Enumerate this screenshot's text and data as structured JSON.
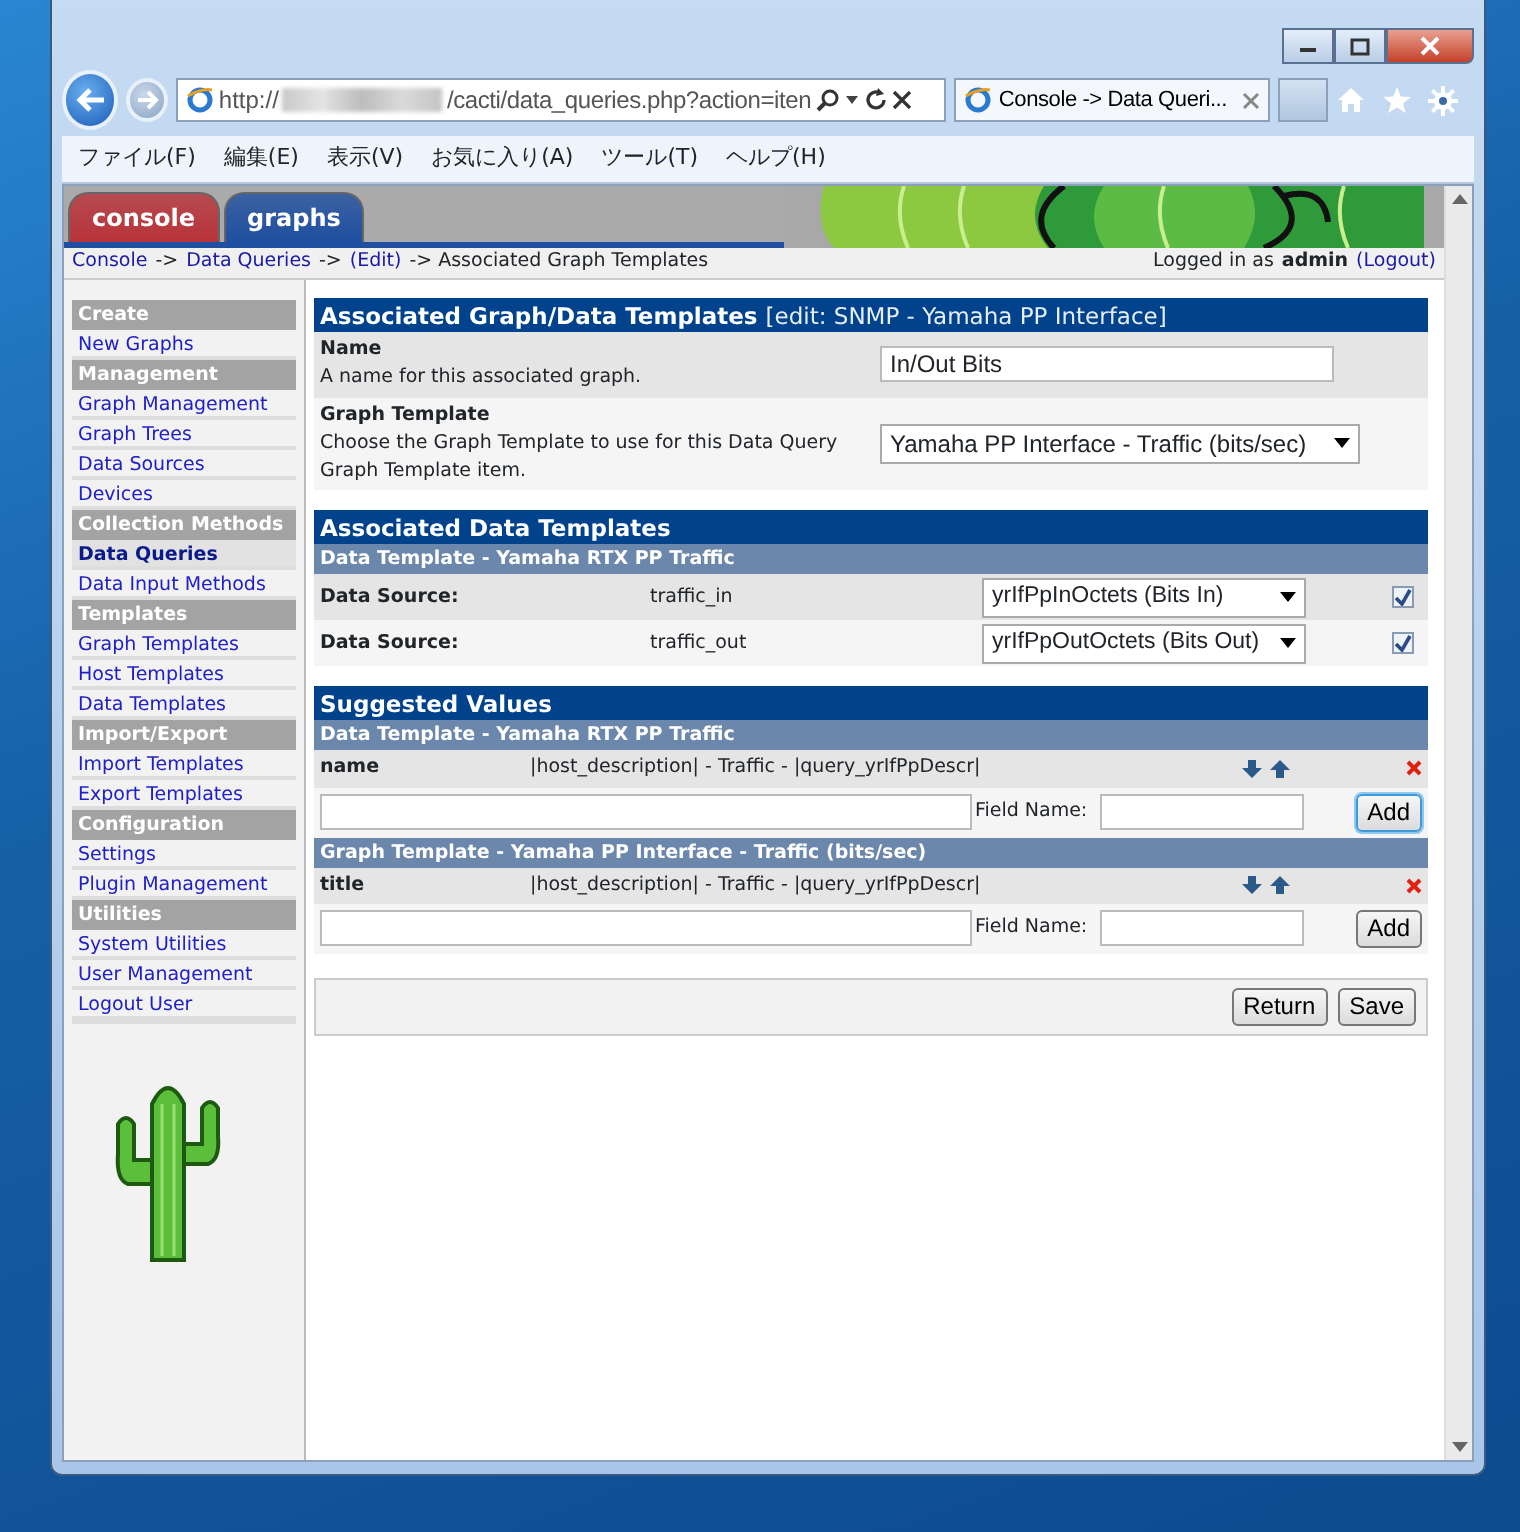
{
  "browser": {
    "url_scheme": "http://",
    "url_path": "/cacti/data_queries.php?action=iten",
    "tab_title": "Console -> Data Queri...",
    "menu": [
      "ファイル(F)",
      "編集(E)",
      "表示(V)",
      "お気に入り(A)",
      "ツール(T)",
      "ヘルプ(H)"
    ]
  },
  "header_tabs": [
    {
      "label": "console",
      "color": "#b8333a"
    },
    {
      "label": "graphs",
      "color": "#1f4fa0"
    }
  ],
  "breadcrumb": [
    {
      "text": "Console",
      "kind": "link"
    },
    {
      "text": "->",
      "kind": "text"
    },
    {
      "text": "Data Queries",
      "kind": "link"
    },
    {
      "text": "->",
      "kind": "text"
    },
    {
      "text": "(Edit)",
      "kind": "link"
    },
    {
      "text": "-> Associated Graph Templates",
      "kind": "text"
    }
  ],
  "login": {
    "prefix": "Logged in as",
    "user": "admin",
    "logout": "(Logout)"
  },
  "sidebar": [
    {
      "heading": "Create",
      "items": [
        {
          "label": "New Graphs",
          "selected": false
        }
      ]
    },
    {
      "heading": "Management",
      "items": [
        {
          "label": "Graph Management",
          "selected": false
        },
        {
          "label": "Graph Trees",
          "selected": false
        },
        {
          "label": "Data Sources",
          "selected": false
        },
        {
          "label": "Devices",
          "selected": false
        }
      ]
    },
    {
      "heading": "Collection Methods",
      "items": [
        {
          "label": "Data Queries",
          "selected": true
        },
        {
          "label": "Data Input Methods",
          "selected": false
        }
      ]
    },
    {
      "heading": "Templates",
      "items": [
        {
          "label": "Graph Templates",
          "selected": false
        },
        {
          "label": "Host Templates",
          "selected": false
        },
        {
          "label": "Data Templates",
          "selected": false
        }
      ]
    },
    {
      "heading": "Import/Export",
      "items": [
        {
          "label": "Import Templates",
          "selected": false
        },
        {
          "label": "Export Templates",
          "selected": false
        }
      ]
    },
    {
      "heading": "Configuration",
      "items": [
        {
          "label": "Settings",
          "selected": false
        },
        {
          "label": "Plugin Management",
          "selected": false
        }
      ]
    },
    {
      "heading": "Utilities",
      "items": [
        {
          "label": "System Utilities",
          "selected": false
        },
        {
          "label": "User Management",
          "selected": false
        },
        {
          "label": "Logout User",
          "selected": false
        }
      ]
    }
  ],
  "graph_templates": {
    "title": "Associated Graph/Data Templates",
    "subtitle": "[edit: SNMP - Yamaha PP Interface]",
    "fields": [
      {
        "label": "Name",
        "description": "A name for this associated graph.",
        "kind": "text",
        "value": "In/Out Bits"
      },
      {
        "label": "Graph Template",
        "description": "Choose the Graph Template to use for this Data Query Graph Template item.",
        "kind": "select",
        "value": "Yamaha PP Interface - Traffic (bits/sec)"
      }
    ]
  },
  "data_templates": {
    "title": "Associated Data Templates",
    "subheader": "Data Template - Yamaha RTX PP Traffic",
    "rows": [
      {
        "label": "Data Source:",
        "name": "traffic_in",
        "value": "yrIfPpInOctets (Bits In)",
        "checked": true
      },
      {
        "label": "Data Source:",
        "name": "traffic_out",
        "value": "yrIfPpOutOctets (Bits Out)",
        "checked": true
      }
    ]
  },
  "suggested_values": {
    "title": "Suggested Values",
    "groups": [
      {
        "header": "Data Template - Yamaha RTX PP Traffic",
        "field": "name",
        "value": "|host_description| - Traffic - |query_yrIfPpDescr|",
        "field_name_label": "Field Name:",
        "add_label": "Add",
        "add_focused": true
      },
      {
        "header": "Graph Template - Yamaha PP Interface - Traffic (bits/sec)",
        "field": "title",
        "value": "|host_description| - Traffic - |query_yrIfPpDescr|",
        "field_name_label": "Field Name:",
        "add_label": "Add",
        "add_focused": false
      }
    ]
  },
  "buttons": [
    "Return",
    "Save"
  ]
}
